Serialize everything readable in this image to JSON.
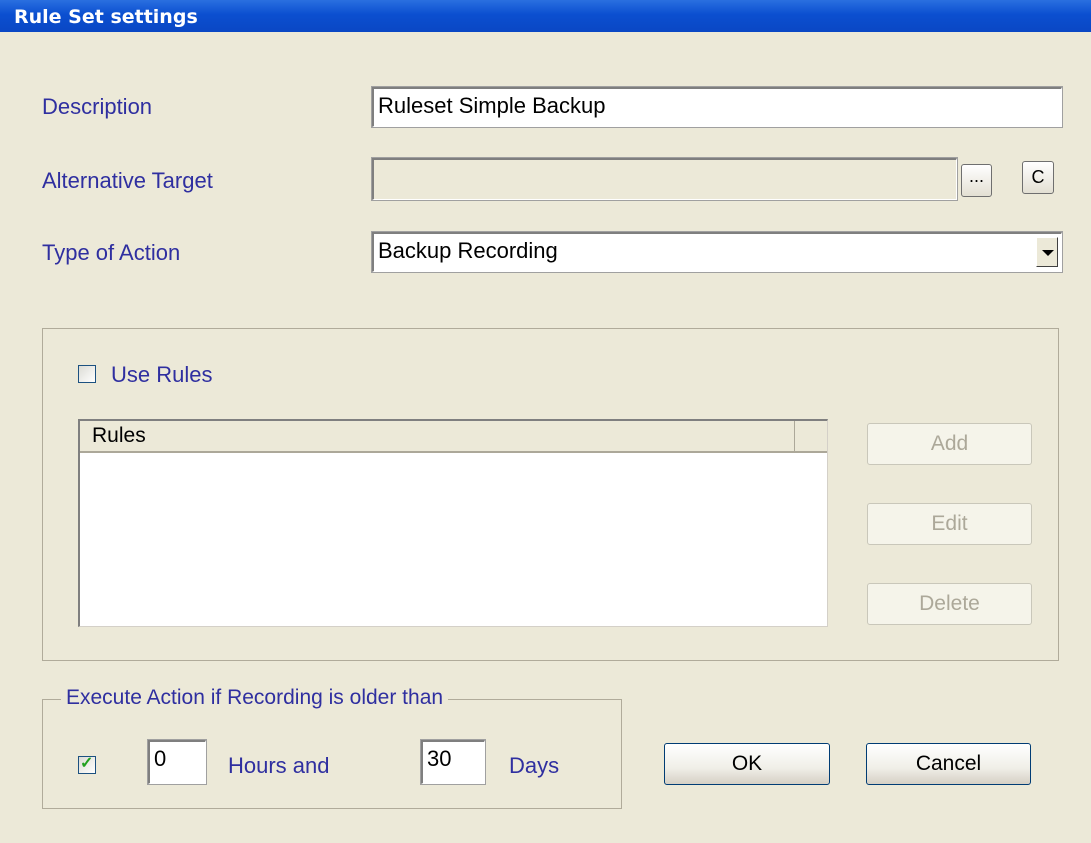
{
  "window": {
    "title": "Rule Set settings"
  },
  "form": {
    "description_label": "Description",
    "description_value": "Ruleset Simple Backup",
    "alt_target_label": "Alternative Target",
    "alt_target_value": "",
    "browse_label": "...",
    "clear_label": "C",
    "action_type_label": "Type of Action",
    "action_type_value": "Backup Recording"
  },
  "rules": {
    "use_rules_label": "Use Rules",
    "use_rules_checked": false,
    "column_header": "Rules",
    "items": [],
    "add_label": "Add",
    "edit_label": "Edit",
    "delete_label": "Delete"
  },
  "execute": {
    "group_label": "Execute Action if Recording is older than",
    "enabled_checked": true,
    "hours_value": "0",
    "hours_label": "Hours and",
    "days_value": "30",
    "days_label": "Days"
  },
  "buttons": {
    "ok_label": "OK",
    "cancel_label": "Cancel"
  },
  "colors": {
    "title_bar": "#0a47c4",
    "label": "#2f2fa0",
    "background": "#ece9d8"
  }
}
